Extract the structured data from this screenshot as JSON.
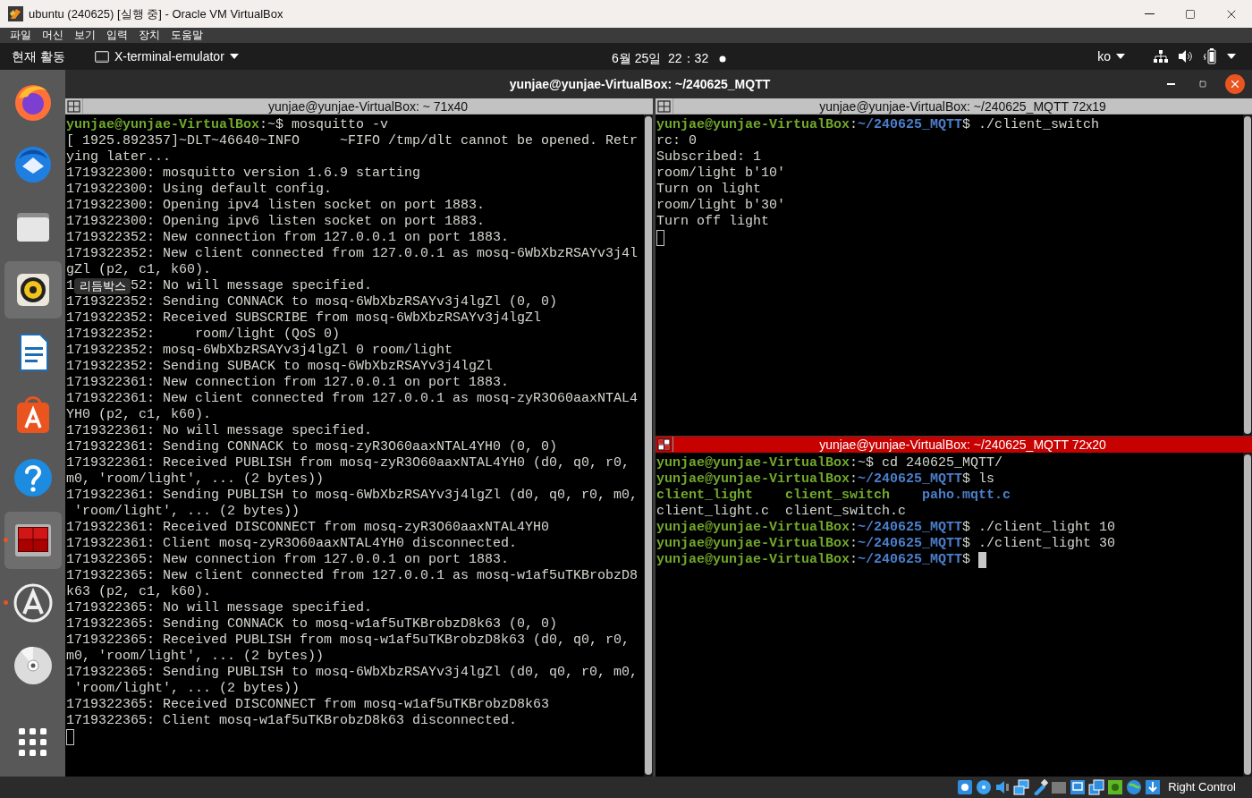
{
  "window": {
    "title": "ubuntu (240625) [실행 중] - Oracle VM VirtualBox"
  },
  "menu": [
    "파일",
    "머신",
    "보기",
    "입력",
    "장치",
    "도움말"
  ],
  "top_bar": {
    "activities": "현재 활동",
    "app_menu": "X-terminal-emulator",
    "clock": "6월 25일  22：32",
    "input_source": "ko"
  },
  "dock": {
    "tooltip": "리듬박스",
    "items": [
      {
        "kind": "browser",
        "highlighted": false,
        "running": false
      },
      {
        "kind": "mail",
        "highlighted": false,
        "running": false
      },
      {
        "kind": "files",
        "highlighted": false,
        "running": false
      },
      {
        "kind": "music",
        "highlighted": true,
        "running": false
      },
      {
        "kind": "writer",
        "highlighted": false,
        "running": false
      },
      {
        "kind": "store",
        "highlighted": false,
        "running": false
      },
      {
        "kind": "help",
        "highlighted": false,
        "running": false
      },
      {
        "kind": "terminal",
        "highlighted": true,
        "running": true
      },
      {
        "kind": "updater",
        "highlighted": false,
        "running": true
      },
      {
        "kind": "disc",
        "highlighted": false,
        "running": false
      }
    ]
  },
  "terminator": {
    "title": "yunjae@yunjae-VirtualBox: ~/240625_MQTT",
    "panes": [
      {
        "title": "yunjae@yunjae-VirtualBox: ~ 71x40",
        "focused": false,
        "lines": [
          [
            {
              "kind": "user",
              "text": "yunjae@yunjae-VirtualBox"
            },
            {
              "kind": "plain",
              "text": ":~$ mosquitto -v"
            }
          ],
          "[ 1925.892357]~DLT~46640~INFO     ~FIFO /tmp/dlt cannot be opened. Retr",
          "ying later...",
          "1719322300: mosquitto version 1.6.9 starting",
          "1719322300: Using default config.",
          "1719322300: Opening ipv4 listen socket on port 1883.",
          "1719322300: Opening ipv6 listen socket on port 1883.",
          "1719322352: New connection from 127.0.0.1 on port 1883.",
          "1719322352: New client connected from 127.0.0.1 as mosq-6WbXbzRSAYv3j4l",
          "gZl (p2, c1, k60).",
          [
            {
              "kind": "plain",
              "text": "1"
            },
            {
              "kind": "covered"
            },
            {
              "kind": "plain",
              "text": "52: No will message specified."
            }
          ],
          "1719322352: Sending CONNACK to mosq-6WbXbzRSAYv3j4lgZl (0, 0)",
          "1719322352: Received SUBSCRIBE from mosq-6WbXbzRSAYv3j4lgZl",
          "1719322352:     room/light (QoS 0)",
          "1719322352: mosq-6WbXbzRSAYv3j4lgZl 0 room/light",
          "1719322352: Sending SUBACK to mosq-6WbXbzRSAYv3j4lgZl",
          "1719322361: New connection from 127.0.0.1 on port 1883.",
          "1719322361: New client connected from 127.0.0.1 as mosq-zyR3O60aaxNTAL4",
          "YH0 (p2, c1, k60).",
          "1719322361: No will message specified.",
          "1719322361: Sending CONNACK to mosq-zyR3O60aaxNTAL4YH0 (0, 0)",
          "1719322361: Received PUBLISH from mosq-zyR3O60aaxNTAL4YH0 (d0, q0, r0,",
          "m0, 'room/light', ... (2 bytes))",
          "1719322361: Sending PUBLISH to mosq-6WbXbzRSAYv3j4lgZl (d0, q0, r0, m0,",
          " 'room/light', ... (2 bytes))",
          "1719322361: Received DISCONNECT from mosq-zyR3O60aaxNTAL4YH0",
          "1719322361: Client mosq-zyR3O60aaxNTAL4YH0 disconnected.",
          "1719322365: New connection from 127.0.0.1 on port 1883.",
          "1719322365: New client connected from 127.0.0.1 as mosq-w1af5uTKBrobzD8",
          "k63 (p2, c1, k60).",
          "1719322365: No will message specified.",
          "1719322365: Sending CONNACK to mosq-w1af5uTKBrobzD8k63 (0, 0)",
          "1719322365: Received PUBLISH from mosq-w1af5uTKBrobzD8k63 (d0, q0, r0,",
          "m0, 'room/light', ... (2 bytes))",
          "1719322365: Sending PUBLISH to mosq-6WbXbzRSAYv3j4lgZl (d0, q0, r0, m0,",
          " 'room/light', ... (2 bytes))",
          "1719322365: Received DISCONNECT from mosq-w1af5uTKBrobzD8k63",
          "1719322365: Client mosq-w1af5uTKBrobzD8k63 disconnected."
        ]
      },
      {
        "title": "yunjae@yunjae-VirtualBox: ~/240625_MQTT 72x19",
        "focused": false,
        "lines": [
          [
            {
              "kind": "user",
              "text": "yunjae@yunjae-VirtualBox"
            },
            {
              "kind": "plain",
              "text": ":"
            },
            {
              "kind": "path",
              "text": "~/240625_MQTT"
            },
            {
              "kind": "plain",
              "text": "$ ./client_switch"
            }
          ],
          "rc: 0",
          "Subscribed: 1",
          "room/light b'10'",
          "Turn on light",
          "room/light b'30'",
          "Turn off light"
        ]
      },
      {
        "title": "yunjae@yunjae-VirtualBox: ~/240625_MQTT 72x20",
        "focused": true,
        "lines": [
          [
            {
              "kind": "user",
              "text": "yunjae@yunjae-VirtualBox"
            },
            {
              "kind": "plain",
              "text": ":~$ cd 240625_MQTT/"
            }
          ],
          [
            {
              "kind": "user",
              "text": "yunjae@yunjae-VirtualBox"
            },
            {
              "kind": "plain",
              "text": ":"
            },
            {
              "kind": "path",
              "text": "~/240625_MQTT"
            },
            {
              "kind": "plain",
              "text": "$ ls"
            }
          ],
          [
            {
              "kind": "exe",
              "text": "client_light"
            },
            {
              "kind": "exe",
              "text": "client_switch"
            },
            {
              "kind": "dir",
              "text": "paho.mqtt.c"
            }
          ],
          [
            {
              "kind": "file",
              "text": "client_light.c"
            },
            {
              "kind": "file",
              "text": "client_switch.c"
            }
          ],
          [
            {
              "kind": "user",
              "text": "yunjae@yunjae-VirtualBox"
            },
            {
              "kind": "plain",
              "text": ":"
            },
            {
              "kind": "path",
              "text": "~/240625_MQTT"
            },
            {
              "kind": "plain",
              "text": "$ ./client_light 10"
            }
          ],
          [
            {
              "kind": "user",
              "text": "yunjae@yunjae-VirtualBox"
            },
            {
              "kind": "plain",
              "text": ":"
            },
            {
              "kind": "path",
              "text": "~/240625_MQTT"
            },
            {
              "kind": "plain",
              "text": "$ ./client_light 30"
            }
          ],
          [
            {
              "kind": "user",
              "text": "yunjae@yunjae-VirtualBox"
            },
            {
              "kind": "plain",
              "text": ":"
            },
            {
              "kind": "path",
              "text": "~/240625_MQTT"
            },
            {
              "kind": "plain",
              "text": "$"
            }
          ]
        ]
      }
    ]
  },
  "status_bar": {
    "host_key": "Right Control"
  }
}
